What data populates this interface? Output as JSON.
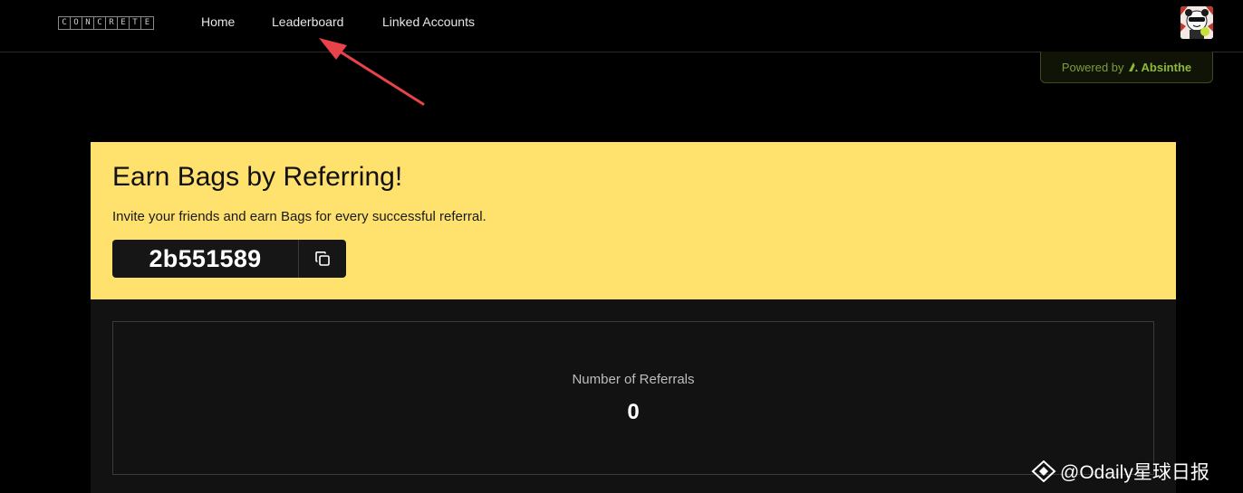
{
  "nav": {
    "logo_letters": [
      "C",
      "O",
      "N",
      "C",
      "R",
      "E",
      "T",
      "E"
    ],
    "links": [
      "Home",
      "Leaderboard",
      "Linked Accounts"
    ]
  },
  "powered_by": {
    "prefix": "Powered by",
    "brand": "Absinthe"
  },
  "referral": {
    "title": "Earn Bags by Referring!",
    "description": "Invite your friends and earn Bags for every successful referral.",
    "code": "2b551589",
    "copy_icon": "copy-icon"
  },
  "stats": {
    "label": "Number of Referrals",
    "value": "0"
  },
  "watermark": {
    "text": "@Odaily星球日报"
  },
  "colors": {
    "banner": "#ffe16e",
    "page_background": "#000000",
    "annotation_arrow": "#e8434a",
    "powered_accent": "#8fb83a"
  }
}
